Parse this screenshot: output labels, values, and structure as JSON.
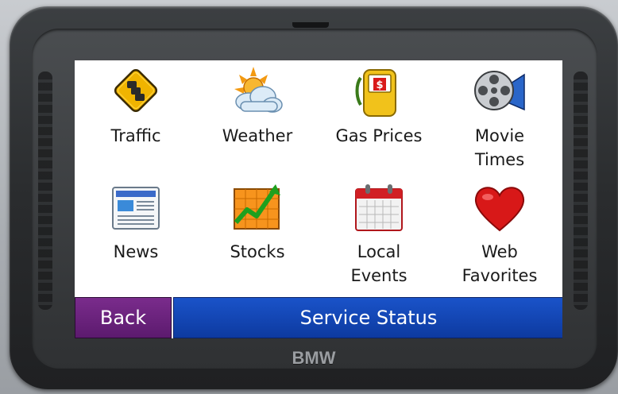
{
  "device": {
    "brand": "BMW"
  },
  "menu": {
    "items": [
      {
        "label": "Traffic",
        "icon": "traffic-sign-icon"
      },
      {
        "label": "Weather",
        "icon": "weather-icon"
      },
      {
        "label": "Gas Prices",
        "icon": "gas-pump-icon"
      },
      {
        "label": "Movie\nTimes",
        "icon": "film-reel-icon"
      },
      {
        "label": "News",
        "icon": "newspaper-icon"
      },
      {
        "label": "Stocks",
        "icon": "stocks-chart-icon"
      },
      {
        "label": "Local\nEvents",
        "icon": "calendar-icon"
      },
      {
        "label": "Web\nFavorites",
        "icon": "heart-icon"
      }
    ]
  },
  "footer": {
    "back_label": "Back",
    "status_label": "Service Status"
  },
  "colors": {
    "back": "#6a2380",
    "status": "#1446b8",
    "traffic_sign": "#f0b400",
    "heart": "#d81818"
  }
}
